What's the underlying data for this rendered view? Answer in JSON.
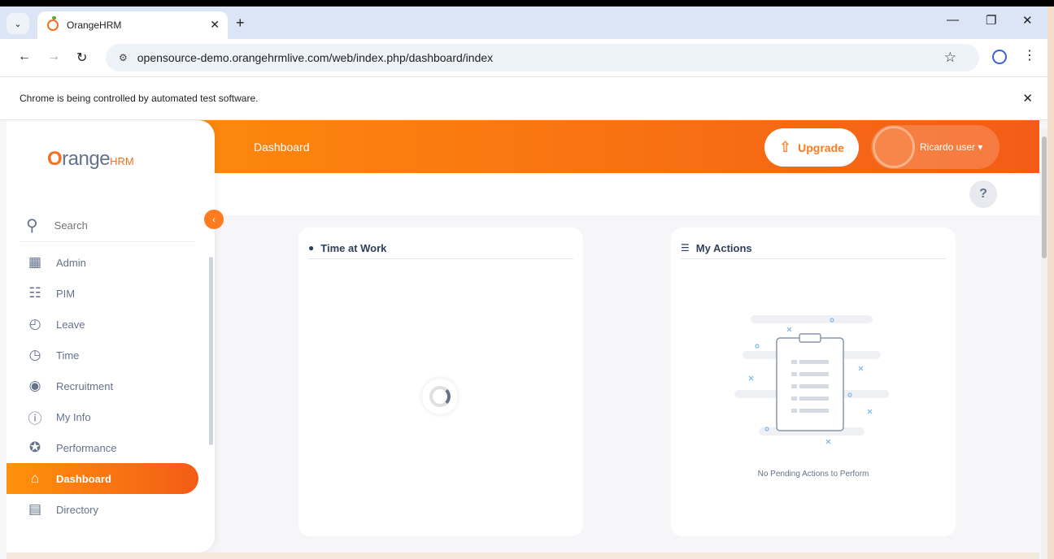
{
  "browser": {
    "tab_title": "OrangeHRM",
    "tab_close": "✕",
    "new_tab": "+",
    "tab_list": "⌄",
    "url": "opensource-demo.orangehrmlive.com/web/index.php/dashboard/index",
    "window_controls": [
      "—",
      "❐",
      "✕"
    ],
    "nav": {
      "back": "←",
      "forward": "→",
      "reload": "↻"
    },
    "star": "☆",
    "menu": "⋮",
    "site_info": "⚙"
  },
  "infobar": {
    "message": "Chrome is being controlled by automated test software.",
    "close": "✕"
  },
  "header": {
    "title": "Dashboard",
    "upgrade_label": "Upgrade",
    "upgrade_icon": "⇧",
    "user_name": "Ricardo user ▾",
    "help_label": "?"
  },
  "sidebar": {
    "logo_o": "O",
    "logo_range": "range",
    "logo_hrm": "HRM",
    "collapse": "‹",
    "search_placeholder": "Search",
    "items": [
      {
        "label": "Admin",
        "icon": "▦"
      },
      {
        "label": "PIM",
        "icon": "☷"
      },
      {
        "label": "Leave",
        "icon": "◴"
      },
      {
        "label": "Time",
        "icon": "◷"
      },
      {
        "label": "Recruitment",
        "icon": "◉"
      },
      {
        "label": "My Info",
        "icon": "ⓘ"
      },
      {
        "label": "Performance",
        "icon": "✪"
      },
      {
        "label": "Dashboard",
        "icon": "⌂"
      },
      {
        "label": "Directory",
        "icon": "▤"
      }
    ]
  },
  "widgets": {
    "time_at_work": {
      "title": "Time at Work",
      "icon": "●"
    },
    "my_actions": {
      "title": "My Actions",
      "icon": "☰",
      "empty_message": "No Pending Actions to Perform"
    }
  },
  "colors": {
    "brand_orange": "#ff7b1d",
    "text_grey": "#64728c"
  }
}
